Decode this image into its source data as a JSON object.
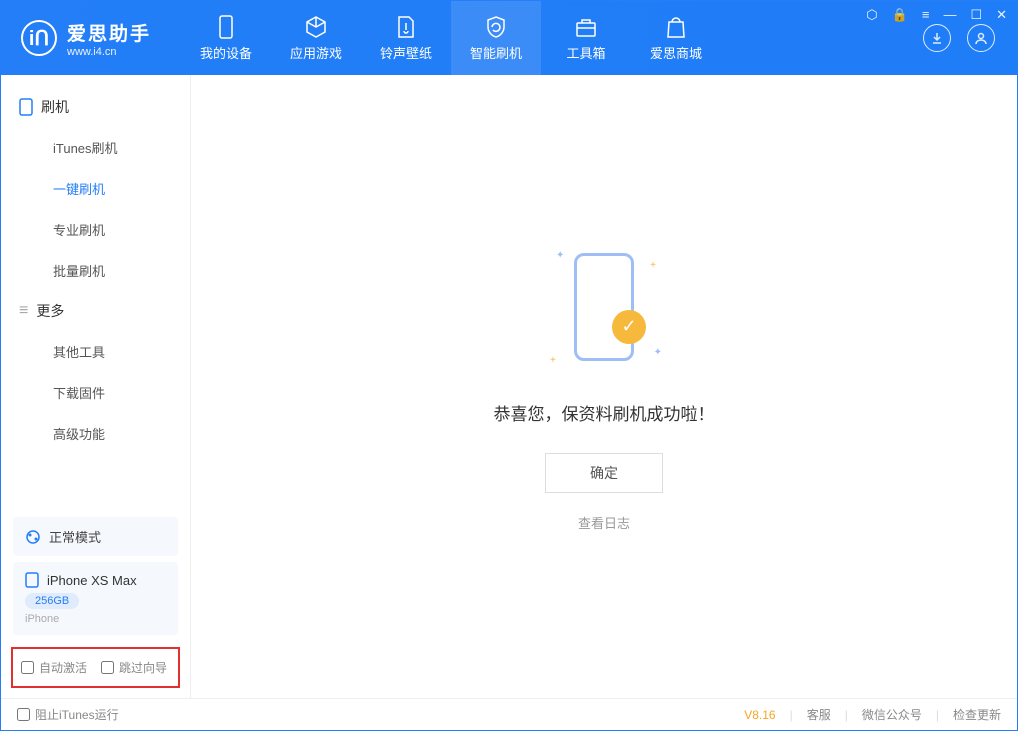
{
  "app": {
    "title": "爱思助手",
    "subtitle": "www.i4.cn"
  },
  "nav": {
    "tabs": [
      {
        "label": "我的设备"
      },
      {
        "label": "应用游戏"
      },
      {
        "label": "铃声壁纸"
      },
      {
        "label": "智能刷机"
      },
      {
        "label": "工具箱"
      },
      {
        "label": "爱思商城"
      }
    ]
  },
  "sidebar": {
    "section1_title": "刷机",
    "items1": [
      {
        "label": "iTunes刷机"
      },
      {
        "label": "一键刷机"
      },
      {
        "label": "专业刷机"
      },
      {
        "label": "批量刷机"
      }
    ],
    "section2_title": "更多",
    "items2": [
      {
        "label": "其他工具"
      },
      {
        "label": "下载固件"
      },
      {
        "label": "高级功能"
      }
    ],
    "mode_label": "正常模式",
    "device_name": "iPhone XS Max",
    "device_capacity": "256GB",
    "device_type": "iPhone",
    "checkbox_auto_activate": "自动激活",
    "checkbox_skip_guide": "跳过向导"
  },
  "main": {
    "success_message": "恭喜您，保资料刷机成功啦！",
    "ok_button": "确定",
    "view_log": "查看日志"
  },
  "footer": {
    "block_itunes": "阻止iTunes运行",
    "version": "V8.16",
    "customer_service": "客服",
    "wechat": "微信公众号",
    "check_update": "检查更新"
  }
}
